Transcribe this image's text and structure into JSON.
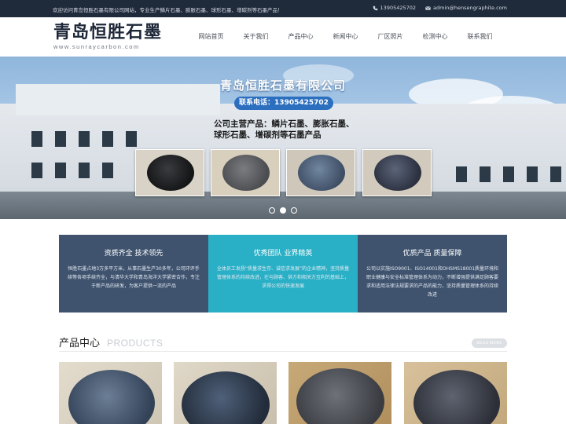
{
  "topbar": {
    "welcome": "欢迎访问青岛恒胜石墨有限公司网站，专业生产鳞片石墨、膨胀石墨、球形石墨、增碳剂等石墨产品！",
    "phone": "13905425702",
    "email": "admin@hensengraphite.com",
    "phone_icon": "phone-icon",
    "email_icon": "mail-icon"
  },
  "logo": {
    "cn": "青岛恒胜石墨",
    "en": "www.sunraycarbon.com"
  },
  "nav": {
    "items": [
      "网站首页",
      "关于我们",
      "产品中心",
      "新闻中心",
      "厂区照片",
      "检测中心",
      "联系我们"
    ]
  },
  "banner": {
    "company": "青岛恒胜石墨有限公司",
    "phone_line": "联系电话：13905425702",
    "products_line1": "公司主营产品：鳞片石墨、膨胀石墨、",
    "products_line2": "球形石墨、增碳剂等石墨产品",
    "slides_count": 3,
    "active_slide": 2
  },
  "features": [
    {
      "title": "资质齐全 技术领先",
      "desc": "恒胜石墨占地3万多平方米，从事石墨生产30多年，公司环评手续等各项手续齐全，与清华大学和青岛海洋大学紧密合作，专注于新产品的研发，为客户提供一流的产品",
      "color": "#3f536e"
    },
    {
      "title": "优秀团队 业界精英",
      "desc": "全体员工发扬“质量求生存、诚信求发展”的企业精神，坚持质量管理体系的持续改进，在与顾客、供方和相关方互利的基础上，求得公司的快速发展",
      "color": "#2ab0c6"
    },
    {
      "title": "优质产品 质量保障",
      "desc": "公司以实施ISO9001、ISO14001和OHSMS18001质量环境和职业健康与安全标准管理体系为动力，不断增强提供满足顾客要求和适用法律法规要求的产品的能力，坚持质量管理体系的持续改进",
      "color": "#3f536e"
    }
  ],
  "products_section": {
    "title": "产品中心",
    "title_en": "PRODUCTS",
    "more": "READ MORE"
  }
}
